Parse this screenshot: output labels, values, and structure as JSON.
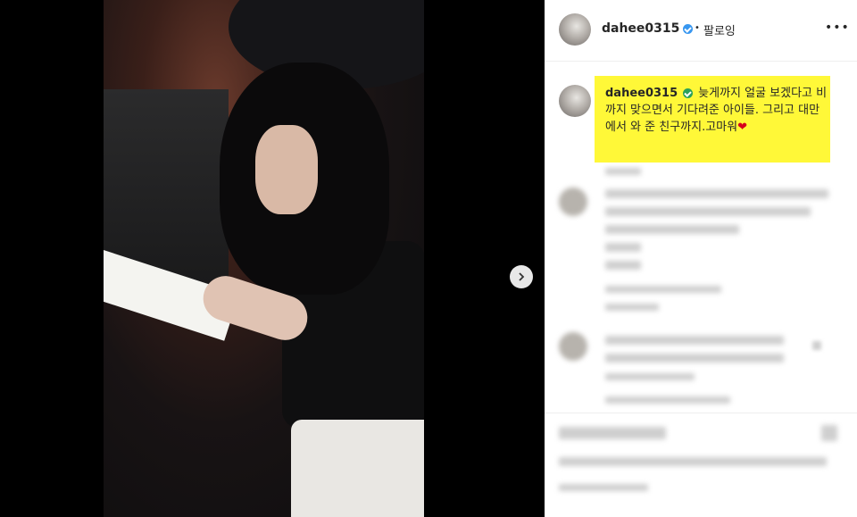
{
  "post": {
    "username": "dahee0315",
    "follow_label": "팔로잉",
    "more_label": "•••",
    "caption": {
      "username": "dahee0315",
      "text": "늦게까지 얼굴 보겠다고 비까지 맞으면서 기다려준 아이들. 그리고 대만에서 와 준 친구까지.고마워",
      "heart": "❤"
    }
  },
  "colors": {
    "highlight": "#fff838",
    "verified": "#3897f0",
    "heart": "#d6001c"
  },
  "icons": {
    "next": "chevron-right-icon",
    "verified": "verified-badge-icon"
  }
}
